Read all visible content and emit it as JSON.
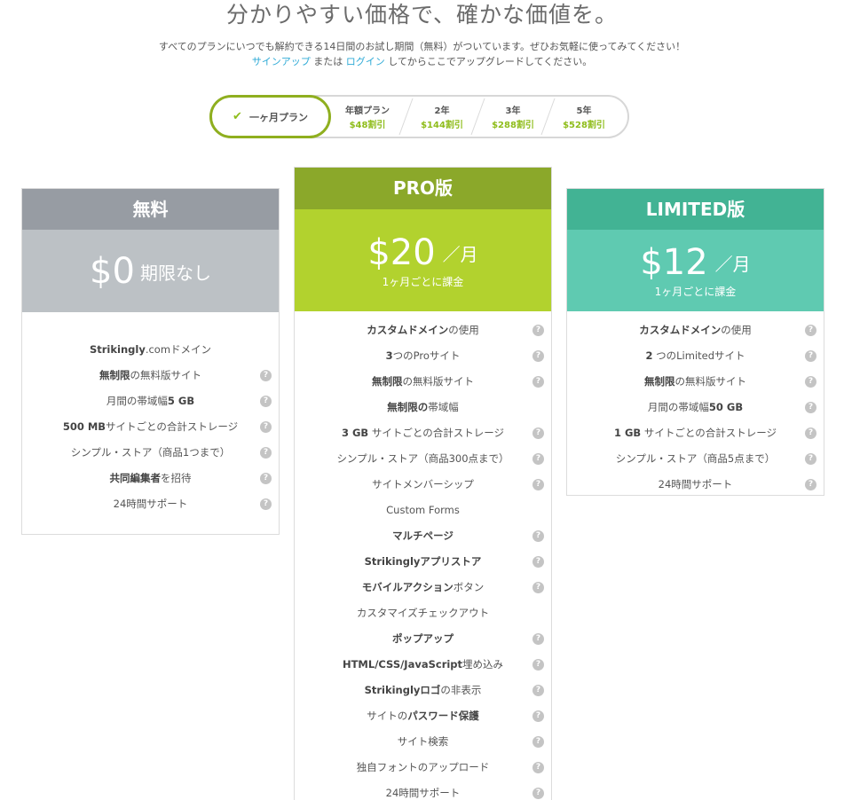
{
  "header": {
    "headline": "分かりやすい価格で、確かな価値を。",
    "sub1": "すべてのプランにいつでも解約できる14日間のお試し期間（無料）がついています。ぜひお気軽に使ってみてください！",
    "signup": "サインアップ",
    "or": " または ",
    "login": "ログイン",
    "sub2_tail": " してからここでアップグレードしてください。"
  },
  "toggle": {
    "monthly": "一ヶ月プラン",
    "options": [
      {
        "label": "年額プラン",
        "save": "$48割引"
      },
      {
        "label": "2年",
        "save": "$144割引"
      },
      {
        "label": "3年",
        "save": "$288割引"
      },
      {
        "label": "5年",
        "save": "$528割引"
      }
    ]
  },
  "plans": {
    "free": {
      "name": "無料",
      "amount": "$0",
      "per": "期限なし",
      "features": [
        {
          "pre": "",
          "b": "Strikingly",
          "post": ".comドメイン",
          "help": false
        },
        {
          "pre": "",
          "b": "無制限",
          "post": "の無料版サイト",
          "help": true
        },
        {
          "pre": "月間の帯域幅",
          "b": "5 GB",
          "post": "",
          "help": true
        },
        {
          "pre": "",
          "b": "500 MB",
          "post": "サイトごとの合計ストレージ",
          "help": true
        },
        {
          "pre": "シンプル・ストア（商品1つまで）",
          "b": "",
          "post": "",
          "help": true
        },
        {
          "pre": "",
          "b": "共同編集者",
          "post": "を招待",
          "help": true
        },
        {
          "pre": "24時間サポート",
          "b": "",
          "post": "",
          "help": true
        }
      ]
    },
    "pro": {
      "name": "PRO版",
      "amount": "$20",
      "per": "／月",
      "note": "1ヶ月ごとに課金",
      "features": [
        {
          "pre": "",
          "b": "カスタムドメイン",
          "post": "の使用",
          "help": true
        },
        {
          "pre": "",
          "b": "3",
          "post": "つのProサイト",
          "help": true
        },
        {
          "pre": "",
          "b": "無制限",
          "post": "の無料版サイト",
          "help": true
        },
        {
          "pre": "",
          "b": "無制限の",
          "post": "帯域幅",
          "help": false
        },
        {
          "pre": "",
          "b": "3 GB",
          "post": " サイトごとの合計ストレージ",
          "help": true
        },
        {
          "pre": "シンプル・ストア（商品300点まで）",
          "b": "",
          "post": "",
          "help": true
        },
        {
          "pre": "サイトメンバーシップ",
          "b": "",
          "post": "",
          "help": true
        },
        {
          "pre": "Custom Forms",
          "b": "",
          "post": "",
          "help": false
        },
        {
          "pre": "",
          "b": "マルチページ",
          "post": "",
          "help": true
        },
        {
          "pre": "",
          "b": "Strikinglyアプリストア",
          "post": "",
          "help": true
        },
        {
          "pre": "",
          "b": "モバイルアクション",
          "post": "ボタン",
          "help": true
        },
        {
          "pre": "カスタマイズチェックアウト",
          "b": "",
          "post": "",
          "help": false
        },
        {
          "pre": "",
          "b": "ポップアップ",
          "post": "",
          "help": true
        },
        {
          "pre": "",
          "b": "HTML/CSS/JavaScript",
          "post": "埋め込み",
          "help": true
        },
        {
          "pre": "",
          "b": "Strikinglyロゴ",
          "post": "の非表示",
          "help": true
        },
        {
          "pre": "サイトの",
          "b": "パスワード保護",
          "post": "",
          "help": true
        },
        {
          "pre": "サイト検索",
          "b": "",
          "post": "",
          "help": true
        },
        {
          "pre": "独自フォントのアップロード",
          "b": "",
          "post": "",
          "help": true
        },
        {
          "pre": "24時間サポート",
          "b": "",
          "post": "",
          "help": true
        }
      ]
    },
    "limited": {
      "name": "LIMITED版",
      "amount": "$12",
      "per": "／月",
      "note": "1ヶ月ごとに課金",
      "features": [
        {
          "pre": "",
          "b": "カスタムドメイン",
          "post": "の使用",
          "help": true
        },
        {
          "pre": "",
          "b": "2",
          "post": " つのLimitedサイト",
          "help": true
        },
        {
          "pre": "",
          "b": "無制限",
          "post": "の無料版サイト",
          "help": true
        },
        {
          "pre": "月間の帯域幅",
          "b": "50 GB",
          "post": "",
          "help": true
        },
        {
          "pre": "",
          "b": "1 GB",
          "post": " サイトごとの合計ストレージ",
          "help": true
        },
        {
          "pre": "シンプル・ストア（商品5点まで）",
          "b": "",
          "post": "",
          "help": true
        },
        {
          "pre": "24時間サポート",
          "b": "",
          "post": "",
          "help": true
        }
      ]
    }
  },
  "help_icon_glyph": "?",
  "check_glyph": "✔"
}
